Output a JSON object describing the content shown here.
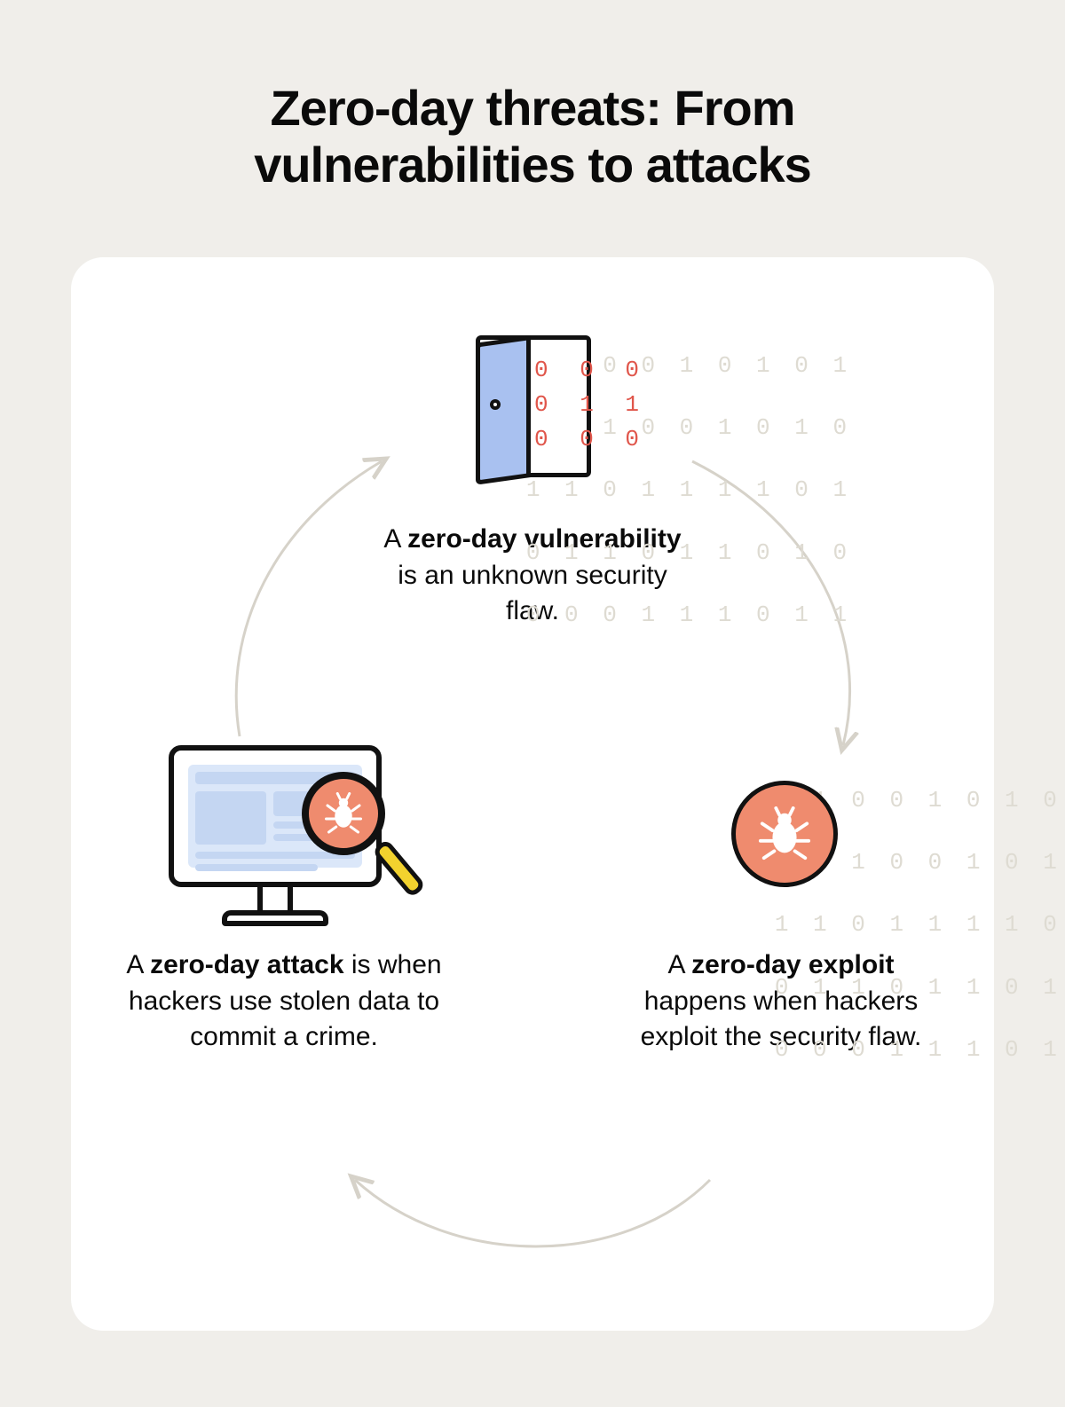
{
  "title_line1": "Zero-day threats: From",
  "title_line2": "vulnerabilities to attacks",
  "nodes": {
    "vulnerability": {
      "prefix": "A ",
      "bold": "zero-day vulnerability",
      "suffix": " is an unknown security flaw."
    },
    "exploit": {
      "prefix": "A ",
      "bold": "zero-day exploit",
      "suffix": " happens when hackers exploit the security flaw."
    },
    "attack": {
      "prefix": "A ",
      "bold": "zero-day attack",
      "suffix": " is when hackers use stolen data to commit a crime."
    }
  },
  "binary_rows": [
    "0 1 0 0 1 0 1 0 1",
    "1 0 1 0 0 1 0 1 0",
    "1 1 0 1 1 1 1 0 1",
    "0 1 1 0 1 1 0 1 0",
    "0 0 0 1 1 1 0 1 1"
  ],
  "binary_red_rows": [
    "0 0 0",
    "0 1 1",
    "0 0 0"
  ],
  "colors": {
    "background": "#f0eeea",
    "card": "#ffffff",
    "text": "#0a0a0a",
    "binary_muted": "#dedbd2",
    "binary_red": "#e0564b",
    "accent_coral": "#ef8b6e",
    "accent_blue": "#a9c1f0",
    "accent_yellow": "#f2d22e",
    "arrow": "#d6d2c9"
  }
}
